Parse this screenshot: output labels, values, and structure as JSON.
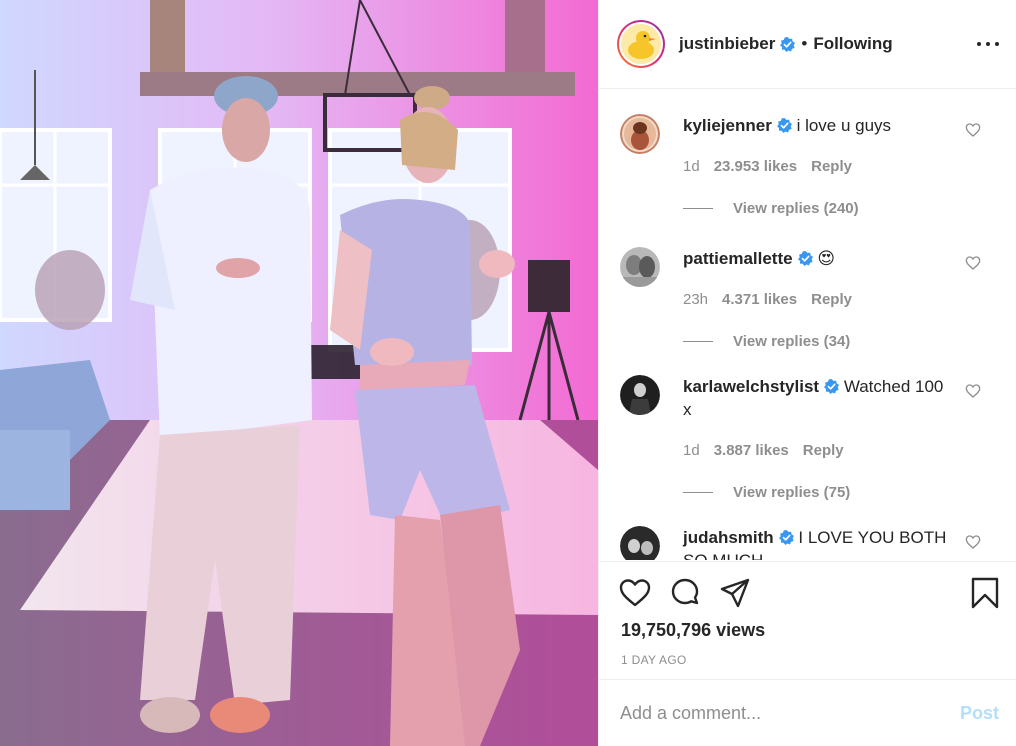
{
  "post": {
    "author": "justinbieber",
    "verified": true,
    "separator": "•",
    "follow_status": "Following",
    "more_icon": "more-horizontal-icon"
  },
  "comments": [
    {
      "user": "kyliejenner",
      "verified": true,
      "text": "i love u guys",
      "time": "1d",
      "likes": "23.953 likes",
      "reply_label": "Reply",
      "view_replies": "View replies (240)"
    },
    {
      "user": "pattiemallette",
      "verified": true,
      "text": "😍",
      "time": "23h",
      "likes": "4.371 likes",
      "reply_label": "Reply",
      "view_replies": "View replies (34)"
    },
    {
      "user": "karlawelchstylist",
      "verified": true,
      "text": "Watched 100 x",
      "time": "1d",
      "likes": "3.887 likes",
      "reply_label": "Reply",
      "view_replies": "View replies (75)"
    },
    {
      "user": "judahsmith",
      "verified": true,
      "text": "I LOVE YOU BOTH SO MUCH"
    }
  ],
  "actions": {
    "like_icon": "heart-icon",
    "comment_icon": "comment-icon",
    "share_icon": "share-icon",
    "save_icon": "bookmark-icon"
  },
  "stats": {
    "views": "19,750,796 views",
    "time_ago": "1 DAY AGO"
  },
  "comment_box": {
    "placeholder": "Add a comment...",
    "post_label": "Post"
  },
  "colors": {
    "verified_blue": "#3897f0",
    "muted_text": "#8e8e8e",
    "post_disabled": "#b2dffc",
    "border": "#efefef"
  }
}
